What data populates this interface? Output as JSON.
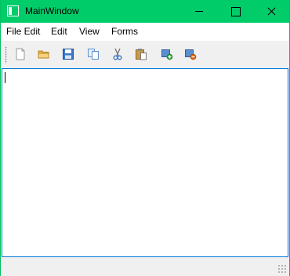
{
  "window": {
    "title": "MainWindow",
    "title_bar_color": "#00cc6a",
    "controls": {
      "minimize_icon": "minimize-icon",
      "maximize_icon": "maximize-icon",
      "close_icon": "close-icon"
    }
  },
  "menubar": {
    "items": [
      {
        "label": "File Edit"
      },
      {
        "label": "Edit"
      },
      {
        "label": "View"
      },
      {
        "label": "Forms"
      }
    ]
  },
  "toolbar": {
    "buttons": [
      {
        "icon": "new-file-icon"
      },
      {
        "icon": "open-folder-icon"
      },
      {
        "icon": "save-icon"
      },
      {
        "icon": "copy-icon"
      },
      {
        "icon": "cut-icon"
      },
      {
        "icon": "paste-icon"
      },
      {
        "icon": "add-form-icon"
      },
      {
        "icon": "remove-form-icon"
      }
    ]
  },
  "editor": {
    "text": "",
    "focus_border_color": "#0078d7"
  }
}
